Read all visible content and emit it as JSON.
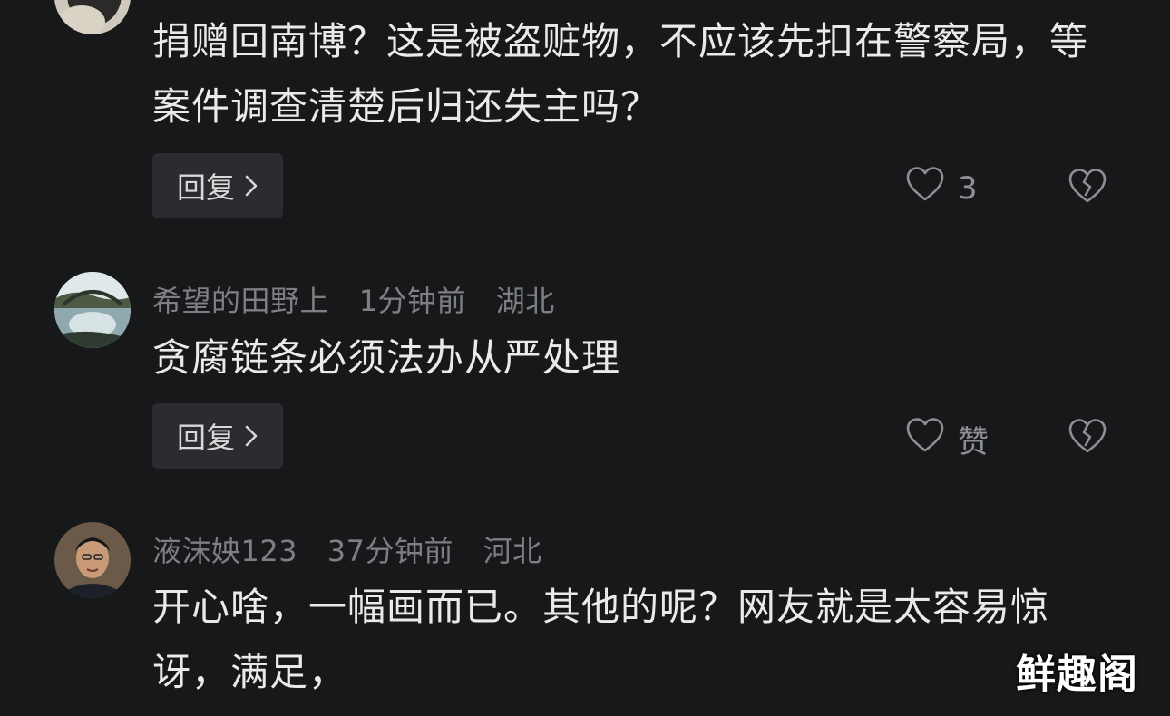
{
  "comments": [
    {
      "text": "捐赠回南博？这是被盗赃物，不应该先扣在警察局，等案件调查清楚后归还失主吗？",
      "reply_label": "回复",
      "like_label": "3",
      "avatar_icon": "user-avatar-icon",
      "like_icon": "heart-outline-icon",
      "dislike_icon": "broken-heart-icon"
    },
    {
      "username": "希望的田野上",
      "time": "1分钟前",
      "location": "湖北",
      "text": "贪腐链条必须法办从严处理",
      "reply_label": "回复",
      "like_label": "赞",
      "avatar_icon": "landscape-avatar-icon",
      "like_icon": "heart-outline-icon",
      "dislike_icon": "broken-heart-icon"
    },
    {
      "username": "液沫姎123",
      "time": "37分钟前",
      "location": "河北",
      "text": "开心啥，一幅画而已。其他的呢？网友就是太容易惊讶，满足，",
      "avatar_icon": "person-avatar-icon"
    }
  ],
  "watermark": "鲜趣阁",
  "colors": {
    "background": "#161819",
    "text": "#eaeaea",
    "meta": "#7d7f82",
    "button_bg": "#2a2c2f",
    "icon": "#8d8f92"
  }
}
